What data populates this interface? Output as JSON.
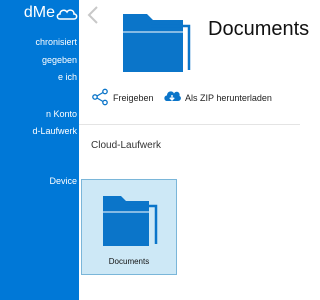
{
  "sidebar": {
    "brand_text": "dMe",
    "items": [
      {
        "label": "chronisiert"
      },
      {
        "label": "gegeben"
      },
      {
        "label": "e ich"
      },
      {
        "label": "n Konto"
      },
      {
        "label": "d-Laufwerk"
      },
      {
        "label": "Device"
      }
    ]
  },
  "header": {
    "title": "Documents"
  },
  "actions": {
    "share_label": "Freigeben",
    "zip_label": "Als ZIP herunterladen"
  },
  "section": {
    "label": "Cloud-Laufwerk"
  },
  "tiles": [
    {
      "label": "Documents",
      "selected": true
    }
  ],
  "colors": {
    "sidebar_bg": "#0078d7",
    "accent": "#0078d7",
    "tile_selected_bg": "#cde8f6"
  }
}
